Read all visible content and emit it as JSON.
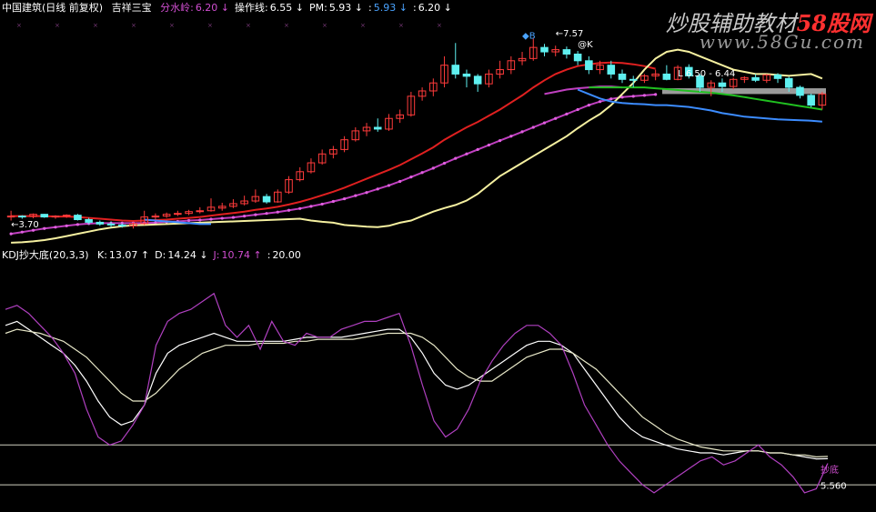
{
  "header": {
    "instrument": "中国建筑(日线 前复权)",
    "indicator_name": "吉祥三宝",
    "fields": [
      {
        "label": "分水岭",
        "value": "6.20",
        "arrow": "↓",
        "label_color": "#d04ed0",
        "value_color": "#d04ed0"
      },
      {
        "label": "操作线",
        "value": "6.55",
        "arrow": "↓",
        "label_color": "#ffffff",
        "value_color": "#ffffff"
      },
      {
        "label": "PM",
        "value": "5.93",
        "arrow": "↓",
        "label_color": "#ffffff",
        "value_color": "#ffffff"
      },
      {
        "label": "",
        "value": "5.93",
        "arrow": "↓",
        "label_color": "#4aa3ff",
        "value_color": "#4aa3ff"
      },
      {
        "label": "",
        "value": "6.20",
        "arrow": "↓",
        "label_color": "#ffffff",
        "value_color": "#ffffff"
      }
    ]
  },
  "kdj_header": {
    "title": "KDJ抄大底(20,3,3)",
    "fields": [
      {
        "label": "K",
        "value": "13.07",
        "arrow": "↑",
        "color": "#ffffff"
      },
      {
        "label": "D",
        "value": "14.24",
        "arrow": "↓",
        "color": "#ffffff"
      },
      {
        "label": "J",
        "value": "10.74",
        "arrow": "↑",
        "color": "#d04ed0"
      },
      {
        "label": "",
        "value": "20.00",
        "arrow": "",
        "color": "#ffffff"
      }
    ]
  },
  "watermark": {
    "cn_prefix": "炒股辅助教材",
    "cn_site": "58股网",
    "url": "www.58Gu.com"
  },
  "colors": {
    "up": "#ff3b3b",
    "down": "#5ff0f0",
    "ma_red": "#e02020",
    "ma_purple": "#c040c0",
    "ma_blue": "#3c8cff",
    "ma_green": "#20c020",
    "ma_yellow": "#f5f0a0",
    "k": "#ffffff",
    "d": "#e8e8c8",
    "j": "#b040c0"
  },
  "chart_data": [
    {
      "type": "candlestick",
      "panel": "price",
      "ylim": [
        3.3,
        8.3
      ],
      "candles": [
        [
          3.78,
          3.92,
          3.7,
          3.8
        ],
        [
          3.8,
          3.82,
          3.74,
          3.79
        ],
        [
          3.79,
          3.86,
          3.75,
          3.84
        ],
        [
          3.84,
          3.85,
          3.76,
          3.78
        ],
        [
          3.78,
          3.82,
          3.74,
          3.8
        ],
        [
          3.8,
          3.84,
          3.76,
          3.82
        ],
        [
          3.82,
          3.85,
          3.7,
          3.72
        ],
        [
          3.72,
          3.76,
          3.62,
          3.66
        ],
        [
          3.66,
          3.7,
          3.58,
          3.62
        ],
        [
          3.62,
          3.68,
          3.55,
          3.6
        ],
        [
          3.6,
          3.64,
          3.54,
          3.58
        ],
        [
          3.58,
          3.66,
          3.52,
          3.63
        ],
        [
          3.63,
          3.92,
          3.6,
          3.78
        ],
        [
          3.78,
          3.86,
          3.72,
          3.8
        ],
        [
          3.8,
          3.88,
          3.76,
          3.84
        ],
        [
          3.84,
          3.92,
          3.8,
          3.86
        ],
        [
          3.86,
          3.94,
          3.82,
          3.9
        ],
        [
          3.9,
          4.0,
          3.86,
          3.92
        ],
        [
          3.92,
          4.2,
          3.9,
          4.0
        ],
        [
          3.98,
          4.1,
          3.92,
          4.02
        ],
        [
          4.02,
          4.18,
          3.98,
          4.08
        ],
        [
          4.08,
          4.26,
          4.04,
          4.14
        ],
        [
          4.14,
          4.4,
          4.1,
          4.24
        ],
        [
          4.24,
          4.3,
          4.08,
          4.12
        ],
        [
          4.12,
          4.4,
          4.1,
          4.34
        ],
        [
          4.34,
          4.7,
          4.3,
          4.62
        ],
        [
          4.62,
          4.9,
          4.58,
          4.8
        ],
        [
          4.8,
          5.1,
          4.76,
          5.0
        ],
        [
          5.0,
          5.3,
          4.96,
          5.2
        ],
        [
          5.2,
          5.38,
          5.1,
          5.3
        ],
        [
          5.3,
          5.6,
          5.24,
          5.52
        ],
        [
          5.52,
          5.8,
          5.48,
          5.72
        ],
        [
          5.72,
          5.9,
          5.6,
          5.8
        ],
        [
          5.8,
          6.0,
          5.7,
          5.76
        ],
        [
          5.76,
          6.1,
          5.72,
          6.0
        ],
        [
          6.0,
          6.2,
          5.9,
          6.08
        ],
        [
          6.08,
          6.6,
          6.04,
          6.5
        ],
        [
          6.5,
          6.7,
          6.4,
          6.62
        ],
        [
          6.62,
          6.9,
          6.5,
          6.8
        ],
        [
          6.8,
          7.4,
          6.7,
          7.2
        ],
        [
          7.2,
          7.7,
          6.9,
          7.0
        ],
        [
          7.0,
          7.1,
          6.7,
          6.95
        ],
        [
          6.95,
          7.0,
          6.6,
          6.78
        ],
        [
          6.78,
          7.1,
          6.7,
          7.0
        ],
        [
          7.0,
          7.3,
          6.9,
          7.1
        ],
        [
          7.1,
          7.4,
          7.0,
          7.3
        ],
        [
          7.3,
          7.5,
          7.2,
          7.35
        ],
        [
          7.35,
          7.8,
          7.3,
          7.6
        ],
        [
          7.6,
          7.68,
          7.4,
          7.5
        ],
        [
          7.5,
          7.64,
          7.4,
          7.55
        ],
        [
          7.55,
          7.62,
          7.35,
          7.45
        ],
        [
          7.45,
          7.52,
          7.2,
          7.3
        ],
        [
          7.3,
          7.4,
          7.0,
          7.1
        ],
        [
          7.1,
          7.3,
          7.0,
          7.2
        ],
        [
          7.2,
          7.3,
          6.9,
          7.0
        ],
        [
          7.0,
          7.1,
          6.8,
          6.88
        ],
        [
          6.88,
          6.96,
          6.7,
          6.86
        ],
        [
          6.86,
          7.0,
          6.8,
          6.96
        ],
        [
          6.96,
          7.1,
          6.86,
          7.0
        ],
        [
          7.0,
          7.2,
          6.86,
          6.88
        ],
        [
          6.88,
          7.2,
          6.86,
          7.15
        ],
        [
          7.15,
          7.22,
          6.9,
          6.96
        ],
        [
          6.96,
          7.0,
          6.6,
          6.7
        ],
        [
          6.7,
          6.86,
          6.5,
          6.8
        ],
        [
          6.8,
          6.9,
          6.6,
          6.72
        ],
        [
          6.72,
          6.92,
          6.66,
          6.88
        ],
        [
          6.88,
          6.95,
          6.8,
          6.92
        ],
        [
          6.92,
          7.0,
          6.82,
          6.86
        ],
        [
          6.86,
          7.0,
          6.8,
          6.98
        ],
        [
          6.98,
          7.02,
          6.8,
          6.9
        ],
        [
          6.9,
          6.94,
          6.6,
          6.7
        ],
        [
          6.7,
          6.74,
          6.45,
          6.52
        ],
        [
          6.52,
          6.56,
          6.25,
          6.3
        ],
        [
          6.3,
          6.6,
          6.2,
          6.55
        ]
      ],
      "ma_lines": [
        {
          "color": "#e02020",
          "values": [
            3.8,
            3.8,
            3.8,
            3.8,
            3.79,
            3.79,
            3.78,
            3.76,
            3.74,
            3.72,
            3.7,
            3.69,
            3.7,
            3.71,
            3.72,
            3.74,
            3.76,
            3.78,
            3.81,
            3.84,
            3.87,
            3.9,
            3.94,
            3.97,
            4.01,
            4.06,
            4.12,
            4.19,
            4.27,
            4.35,
            4.44,
            4.54,
            4.64,
            4.74,
            4.84,
            4.95,
            5.08,
            5.21,
            5.35,
            5.52,
            5.66,
            5.8,
            5.92,
            6.06,
            6.2,
            6.36,
            6.52,
            6.7,
            6.86,
            7.0,
            7.1,
            7.18,
            7.22,
            7.25,
            7.26,
            7.25,
            7.22,
            7.18,
            7.12
          ]
        },
        {
          "color": "#c040c0",
          "values": [
            3.4,
            3.44,
            3.48,
            3.52,
            3.55,
            3.58,
            3.61,
            3.63,
            3.64,
            3.64,
            3.64,
            3.64,
            3.64,
            3.65,
            3.67,
            3.68,
            3.7,
            3.71,
            3.73,
            3.75,
            3.77,
            3.8,
            3.83,
            3.86,
            3.89,
            3.93,
            3.97,
            4.02,
            4.07,
            4.13,
            4.19,
            4.26,
            4.33,
            4.41,
            4.49,
            4.58,
            4.68,
            4.78,
            4.88,
            4.99,
            5.1,
            5.2,
            5.3,
            5.4,
            5.5,
            5.6,
            5.7,
            5.8,
            5.9,
            6.0,
            6.1,
            6.2,
            6.3,
            6.38,
            6.44,
            6.48,
            6.5,
            6.52,
            6.54
          ]
        },
        {
          "color": "#f5f0a0",
          "values": [
            3.2,
            3.21,
            3.23,
            3.26,
            3.3,
            3.35,
            3.4,
            3.45,
            3.5,
            3.54,
            3.57,
            3.59,
            3.6,
            3.61,
            3.62,
            3.63,
            3.64,
            3.65,
            3.66,
            3.67,
            3.68,
            3.69,
            3.7,
            3.71,
            3.72,
            3.73,
            3.74,
            3.7,
            3.67,
            3.65,
            3.6,
            3.58,
            3.56,
            3.55,
            3.58,
            3.65,
            3.7,
            3.8,
            3.9,
            3.98,
            4.05,
            4.15,
            4.3,
            4.5,
            4.7,
            4.85,
            5.0,
            5.15,
            5.3,
            5.45,
            5.6,
            5.78,
            5.95,
            6.1,
            6.3,
            6.55,
            6.8,
            7.1,
            7.35,
            7.5,
            7.55,
            7.5,
            7.4,
            7.3,
            7.2,
            7.1,
            7.05,
            7.0,
            7.0,
            6.98,
            6.96,
            6.98,
            7.0,
            6.9
          ]
        },
        {
          "start": 48,
          "color": "#c040c0",
          "values": [
            6.55,
            6.6,
            6.65,
            6.68,
            6.7,
            6.72,
            6.72,
            6.7
          ]
        },
        {
          "start": 12,
          "color": "#3c8cff",
          "values": [
            3.72,
            3.7,
            3.68,
            3.66,
            3.64,
            3.62,
            3.62
          ]
        },
        {
          "start": 51,
          "color": "#3c8cff",
          "values": [
            6.65,
            6.55,
            6.45,
            6.38,
            6.35,
            6.33,
            6.32,
            6.3,
            6.3,
            6.28,
            6.26,
            6.22,
            6.18,
            6.12,
            6.08,
            6.04,
            6.02,
            6.0,
            5.98,
            5.97,
            5.96,
            5.95,
            5.93
          ]
        },
        {
          "start": 52,
          "color": "#20c020",
          "values": [
            6.7,
            6.7,
            6.7,
            6.7,
            6.7,
            6.7,
            6.68,
            6.66,
            6.64,
            6.62,
            6.6,
            6.58,
            6.55,
            6.52,
            6.48,
            6.44,
            6.4,
            6.36,
            6.32,
            6.28,
            6.24,
            6.2
          ]
        }
      ],
      "annotations": [
        {
          "text": "←3.70",
          "i": 0,
          "y": 3.55,
          "color": "#ffffff"
        },
        {
          "text": "←7.57",
          "i": 49,
          "y": 7.85,
          "color": "#ffffff"
        },
        {
          "text": "@K",
          "i": 51,
          "y": 7.6,
          "color": "#ffffff"
        },
        {
          "text": "◆B",
          "i": 46,
          "y": 7.8,
          "color": "#4aa3ff"
        },
        {
          "text": "L 6.50 - 6.44",
          "i": 60,
          "y": 6.95,
          "color": "#ffffff"
        }
      ],
      "gray_band": [
        6.55,
        6.68
      ]
    },
    {
      "type": "line",
      "panel": "kdj",
      "ylim": [
        -10,
        110
      ],
      "reference_lines": [
        20,
        0
      ],
      "series": [
        {
          "key": "K",
          "color": "#ffffff",
          "values": [
            80,
            82,
            78,
            74,
            70,
            66,
            60,
            52,
            42,
            34,
            30,
            32,
            40,
            56,
            66,
            70,
            72,
            74,
            76,
            74,
            72,
            72,
            72,
            72,
            72,
            73,
            74,
            74,
            74,
            74,
            75,
            76,
            77,
            78,
            78,
            74,
            66,
            56,
            50,
            48,
            50,
            54,
            58,
            62,
            66,
            70,
            72,
            72,
            70,
            66,
            58,
            50,
            42,
            34,
            28,
            24,
            22,
            20,
            18,
            17,
            16,
            16,
            15,
            16,
            17,
            17,
            16,
            16,
            15,
            14,
            13,
            13.07
          ]
        },
        {
          "key": "D",
          "color": "#e8e8c8",
          "values": [
            76,
            78,
            77,
            76,
            74,
            72,
            68,
            64,
            58,
            52,
            46,
            42,
            42,
            46,
            52,
            58,
            62,
            66,
            68,
            70,
            70,
            70,
            71,
            71,
            71,
            72,
            72,
            73,
            73,
            73,
            73,
            74,
            75,
            76,
            76,
            76,
            74,
            70,
            64,
            58,
            54,
            52,
            52,
            56,
            60,
            64,
            66,
            68,
            68,
            66,
            62,
            58,
            52,
            46,
            40,
            34,
            30,
            26,
            23,
            21,
            19,
            18,
            17,
            17,
            17,
            17,
            16,
            16,
            15,
            15,
            14,
            14.24
          ]
        },
        {
          "key": "J",
          "color": "#b040c0",
          "values": [
            88,
            90,
            86,
            80,
            74,
            66,
            56,
            38,
            24,
            20,
            22,
            30,
            40,
            70,
            82,
            86,
            88,
            92,
            96,
            80,
            74,
            80,
            68,
            82,
            72,
            70,
            76,
            74,
            74,
            78,
            80,
            82,
            82,
            84,
            86,
            70,
            50,
            32,
            24,
            28,
            38,
            52,
            62,
            70,
            76,
            80,
            80,
            76,
            70,
            56,
            40,
            30,
            20,
            12,
            6,
            0,
            -4,
            0,
            4,
            8,
            12,
            14,
            10,
            12,
            16,
            20,
            14,
            10,
            4,
            -4,
            -2,
            10.74
          ]
        }
      ],
      "annotations": [
        {
          "text": "抄底",
          "i": 71,
          "y": 6,
          "color": "#d04ed0"
        },
        {
          "text": "5.560",
          "i": 71,
          "y": -2,
          "color": "#ffffff"
        }
      ]
    }
  ]
}
